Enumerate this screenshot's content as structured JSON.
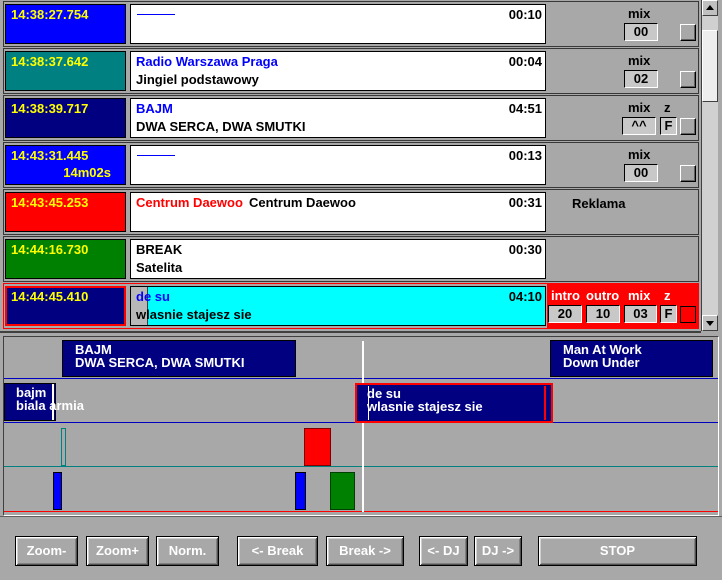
{
  "playlist": {
    "rows": [
      {
        "time": "14:38:27.754",
        "time_bg": "#0000ff",
        "duration": "00:10",
        "mix_label": "mix",
        "mix_value": "00"
      },
      {
        "time": "14:38:37.642",
        "time_bg": "#008080",
        "title": "Radio Warszawa Praga",
        "title_color": "#0000ff",
        "subtitle": "Jingiel podstawowy",
        "duration": "00:04",
        "mix_label": "mix",
        "mix_value": "02"
      },
      {
        "time": "14:38:39.717",
        "time_bg": "#000080",
        "title": "BAJM",
        "title_color": "#0000ff",
        "subtitle": "DWA SERCA, DWA SMUTKI",
        "duration": "04:51",
        "mix_label": "mix",
        "z_label": "z",
        "mix_value": "^^",
        "z_value": "F"
      },
      {
        "time": "14:43:31.445",
        "time_sub": "14m02s",
        "time_bg": "#0000ff",
        "duration": "00:13",
        "mix_label": "mix",
        "mix_value": "00"
      },
      {
        "time": "14:43:45.253",
        "time_bg": "#ff0000",
        "title": "Centrum Daewoo",
        "title_color": "#ff0000",
        "title_overlay": "Centrum Daewoo",
        "duration": "00:31",
        "category": "Reklama"
      },
      {
        "time": "14:44:16.730",
        "time_bg": "#008000",
        "title": "BREAK",
        "title_color": "#000000",
        "subtitle": "Satelita",
        "duration": "00:30"
      },
      {
        "time": "14:44:45.410",
        "time_bg": "#000080",
        "title": "de su",
        "title_color": "#0000ff",
        "subtitle": "wlasnie stajesz sie",
        "duration": "04:10",
        "info_bg": "#00ffff",
        "progress_fraction": 0.04,
        "status_bg": "#ff0000",
        "intro_label": "intro",
        "outro_label": "outro",
        "mix_label": "mix",
        "z_label": "z",
        "intro_value": "20",
        "outro_value": "10",
        "mix_value": "03",
        "z_value": "F"
      }
    ]
  },
  "timeline": {
    "upper_track": [
      {
        "title": "BAJM",
        "subtitle": "DWA SERCA, DWA SMUTKI"
      },
      {
        "title": "Man At Work",
        "subtitle": "Down Under"
      }
    ],
    "lower_track": [
      {
        "title": "bajm",
        "subtitle": "biala armia"
      },
      {
        "title": "de su",
        "subtitle": "wlasnie stajesz sie"
      }
    ]
  },
  "toolbar": {
    "zoom_out": "Zoom-",
    "zoom_in": "Zoom+",
    "zoom_normal": "Norm.",
    "prev_break": "<- Break",
    "next_break": "Break ->",
    "prev_dj": "<- DJ",
    "next_dj": "DJ ->",
    "stop": "STOP"
  }
}
